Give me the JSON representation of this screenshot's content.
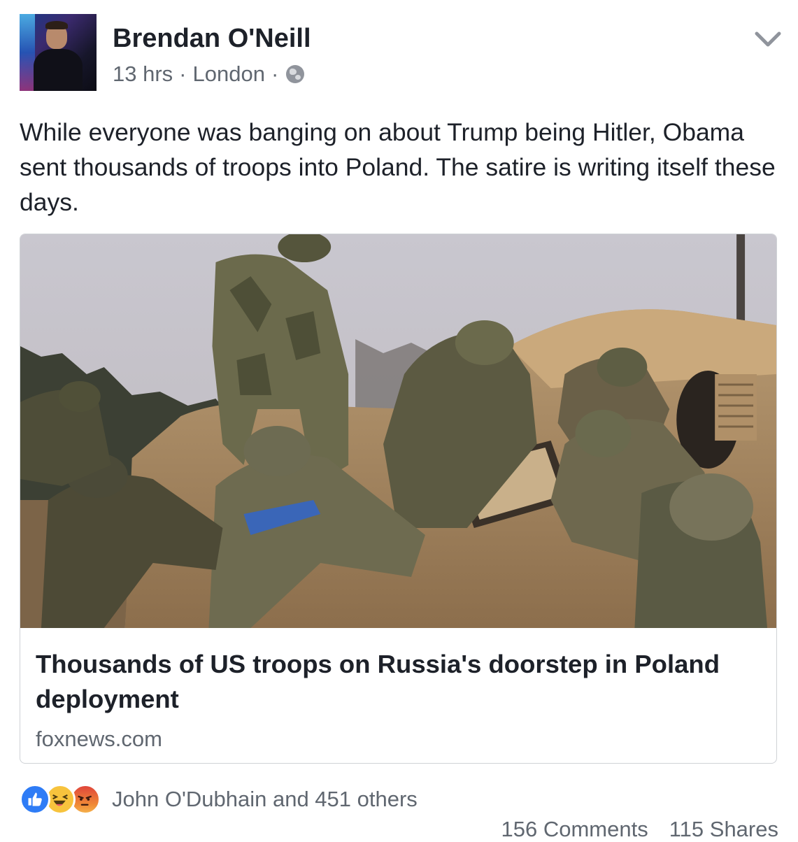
{
  "post": {
    "author": "Brendan O'Neill",
    "time": "13 hrs",
    "location": "London",
    "separator": "·",
    "text": "While everyone was banging on about Trump being Hitler, Obama sent thousands of troops into Poland. The satire is writing itself these days."
  },
  "icons": {
    "avatar": "profile-photo",
    "privacy": "globe-icon",
    "menu": "chevron-down-icon",
    "reactions": [
      "like-icon",
      "haha-icon",
      "angry-icon"
    ]
  },
  "link": {
    "image": "soldiers-on-armored-vehicle-photo",
    "title": "Thousands of US troops on Russia's doorstep in Poland deployment",
    "domain": "foxnews.com"
  },
  "footer": {
    "reaction_text": "John O'Dubhain and 451 others",
    "comments": "156 Comments",
    "shares": "115 Shares"
  },
  "colors": {
    "text": "#1d2129",
    "secondary": "#606770",
    "like_blue": "#2e7cf6",
    "border": "#cfd2d6"
  }
}
